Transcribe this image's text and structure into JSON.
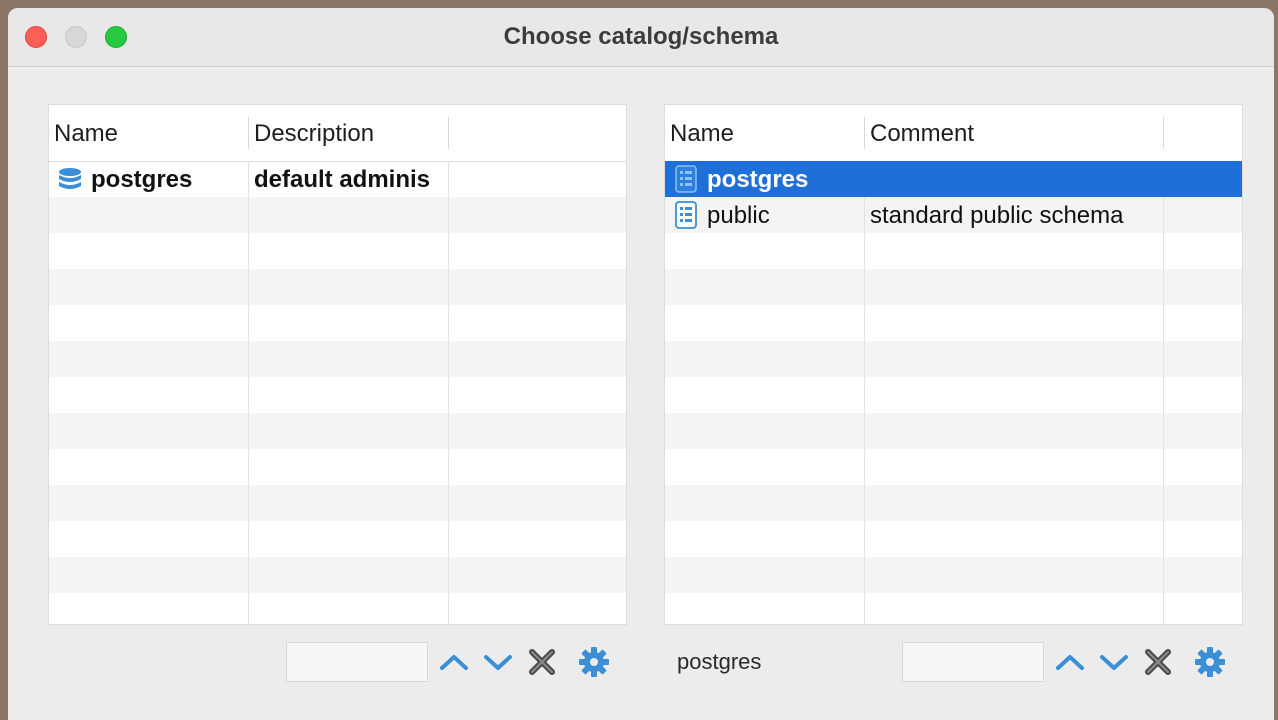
{
  "window": {
    "title": "Choose catalog/schema"
  },
  "left_table": {
    "columns": [
      "Name",
      "Description"
    ],
    "rows": [
      {
        "name": "postgres",
        "description": "default adminis",
        "icon": "database-icon"
      }
    ]
  },
  "right_table": {
    "columns": [
      "Name",
      "Comment"
    ],
    "rows": [
      {
        "name": "postgres",
        "comment": "",
        "icon": "schema-icon",
        "selected": true
      },
      {
        "name": "public",
        "comment": "standard public schema",
        "icon": "schema-icon",
        "selected": false
      }
    ]
  },
  "right_footer": {
    "status": "postgres"
  },
  "colors": {
    "selection": "#1f6fd8",
    "icon_blue": "#3a8fd6",
    "close": "#ff5f57",
    "maximize": "#28c840"
  }
}
